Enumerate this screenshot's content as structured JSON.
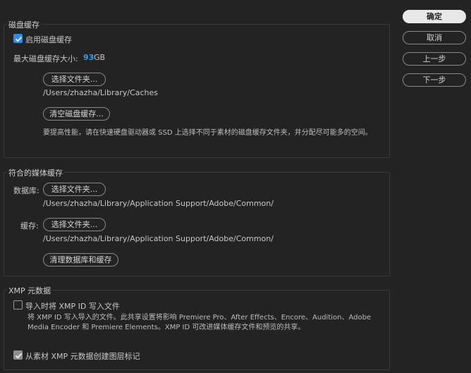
{
  "buttons": {
    "ok": "确定",
    "cancel": "取消",
    "prev": "上一步",
    "next": "下一步"
  },
  "disk_cache": {
    "title": "磁盘缓存",
    "enable_label": "启用磁盘缓存",
    "enable_checked": true,
    "max_size_label": "最大磁盘缓存大小:",
    "max_size_value": "93",
    "max_size_unit": "GB",
    "choose_folder": "选择文件夹...",
    "path": "/Users/zhazha/Library/Caches",
    "clear_button": "清空磁盘缓存...",
    "hint": "要提高性能，请在快速硬盘驱动器或 SSD 上选择不同于素材的磁盘缓存文件夹，并分配尽可能多的空间。"
  },
  "media_cache": {
    "title": "符合的媒体缓存",
    "database_label": "数据库:",
    "database_choose": "选择文件夹...",
    "database_path": "/Users/zhazha/Library/Application Support/Adobe/Common/",
    "cache_label": "缓存:",
    "cache_choose": "选择文件夹...",
    "cache_path": "/Users/zhazha/Library/Application Support/Adobe/Common/",
    "clean_button": "清理数据库和缓存"
  },
  "xmp": {
    "title": "XMP 元数据",
    "write_id_label": "导入时将 XMP ID 写入文件",
    "write_id_checked": false,
    "write_id_hint_line1": "将 XMP ID 写入导入的文件。此共享设置将影响 Premiere Pro、After Effects、Encore、Audition、Adobe",
    "write_id_hint_line2": "Media Encoder 和 Premiere Elements。XMP ID 可改进媒体缓存文件和预览的共享。",
    "create_clip_label": "从素材 XMP 元数据创建图层标记",
    "create_clip_checked": true
  },
  "colors": {
    "accent": "#2d8ceb",
    "background": "#232323"
  }
}
